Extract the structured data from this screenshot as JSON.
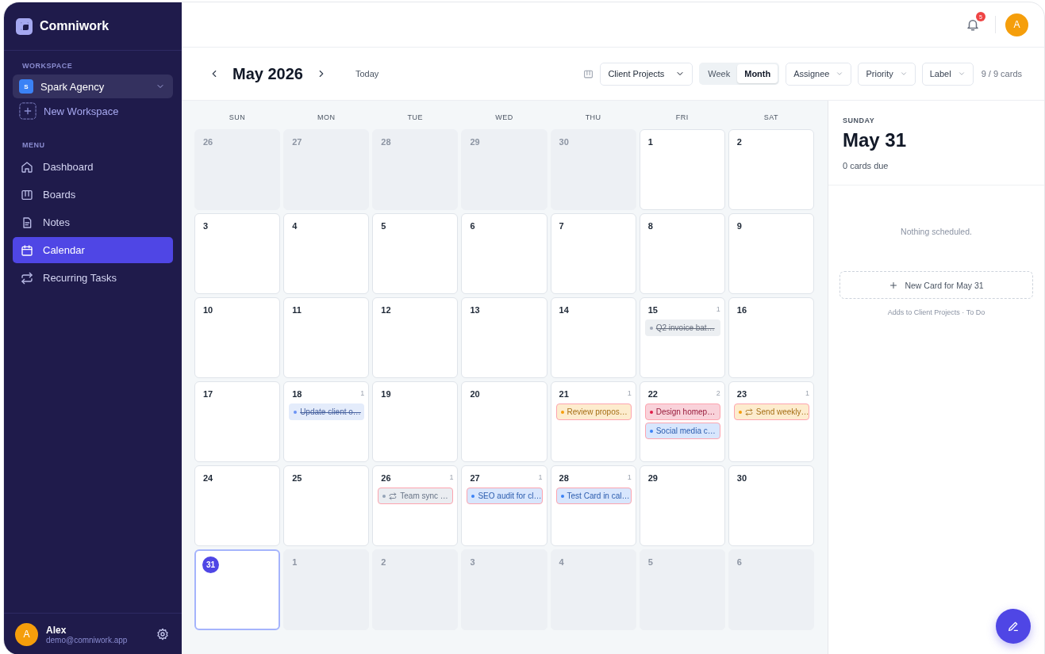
{
  "sidebar": {
    "logo": "Comniwork",
    "workspace_label": "WORKSPACE",
    "workspace": {
      "initial": "S",
      "name": "Spark Agency"
    },
    "new_workspace": "New Workspace",
    "menu_label": "MENU",
    "menu": [
      {
        "label": "Dashboard",
        "kind": "home",
        "selected": false
      },
      {
        "label": "Boards",
        "kind": "board",
        "selected": false
      },
      {
        "label": "Notes",
        "kind": "note",
        "selected": false
      },
      {
        "label": "Calendar",
        "kind": "calendar",
        "selected": true
      },
      {
        "label": "Recurring Tasks",
        "kind": "repeat",
        "selected": false
      }
    ],
    "user": {
      "initial": "A",
      "name": "Alex",
      "email": "demo@comniwork.app"
    }
  },
  "topbar": {
    "notification_count": "5",
    "avatar": "A"
  },
  "toolbar": {
    "month": "May 2026",
    "today": "Today",
    "project": "Client Projects",
    "views": [
      {
        "label": "Week",
        "selected": false
      },
      {
        "label": "Month",
        "selected": true
      }
    ],
    "filters": [
      "Assignee",
      "Priority",
      "Label"
    ],
    "card_count": "9 / 9 cards"
  },
  "calendar": {
    "weekdays": [
      "SUN",
      "MON",
      "TUE",
      "WED",
      "THU",
      "FRI",
      "SAT"
    ],
    "weeks": [
      [
        {
          "day": "26",
          "outside": true,
          "selected": false
        },
        {
          "day": "27",
          "outside": true,
          "selected": false
        },
        {
          "day": "28",
          "outside": true,
          "selected": false
        },
        {
          "day": "29",
          "outside": true,
          "selected": false
        },
        {
          "day": "30",
          "outside": true,
          "selected": false
        },
        {
          "day": "1",
          "outside": false,
          "selected": false
        },
        {
          "day": "2",
          "outside": false,
          "selected": false
        }
      ],
      [
        {
          "day": "3",
          "outside": false,
          "selected": false
        },
        {
          "day": "4",
          "outside": false,
          "selected": false
        },
        {
          "day": "5",
          "outside": false,
          "selected": false
        },
        {
          "day": "6",
          "outside": false,
          "selected": false
        },
        {
          "day": "7",
          "outside": false,
          "selected": false
        },
        {
          "day": "8",
          "outside": false,
          "selected": false
        },
        {
          "day": "9",
          "outside": false,
          "selected": false
        }
      ],
      [
        {
          "day": "10",
          "outside": false,
          "selected": false
        },
        {
          "day": "11",
          "outside": false,
          "selected": false
        },
        {
          "day": "12",
          "outside": false,
          "selected": false
        },
        {
          "day": "13",
          "outside": false,
          "selected": false
        },
        {
          "day": "14",
          "outside": false,
          "selected": false
        },
        {
          "day": "15",
          "outside": false,
          "selected": false,
          "count": "1",
          "cards": [
            {
              "title": "Q2 invoice bat…",
              "color": "#a1a8b8",
              "done": true,
              "recurring": false
            }
          ]
        },
        {
          "day": "16",
          "outside": false,
          "selected": false
        }
      ],
      [
        {
          "day": "17",
          "outside": false,
          "selected": false
        },
        {
          "day": "18",
          "outside": false,
          "selected": false,
          "count": "1",
          "cards": [
            {
              "title": "Update client o…",
              "color": "#6b93f5",
              "done": true,
              "recurring": false
            }
          ]
        },
        {
          "day": "19",
          "outside": false,
          "selected": false
        },
        {
          "day": "20",
          "outside": false,
          "selected": false
        },
        {
          "day": "21",
          "outside": false,
          "selected": false,
          "count": "1",
          "cards": [
            {
              "title": "Review propos…",
              "color": "#f59e0b",
              "done": false,
              "recurring": false
            }
          ]
        },
        {
          "day": "22",
          "outside": false,
          "selected": false,
          "count": "2",
          "cards": [
            {
              "title": "Design homep…",
              "color": "#e11d48",
              "done": false,
              "recurring": false
            },
            {
              "title": "Social media c…",
              "color": "#3b82f6",
              "done": false,
              "recurring": false
            }
          ]
        },
        {
          "day": "23",
          "outside": false,
          "selected": false,
          "count": "1",
          "cards": [
            {
              "title": "Send weekly…",
              "color": "#f59e0b",
              "done": false,
              "recurring": true
            }
          ]
        }
      ],
      [
        {
          "day": "24",
          "outside": false,
          "selected": false
        },
        {
          "day": "25",
          "outside": false,
          "selected": false
        },
        {
          "day": "26",
          "outside": false,
          "selected": false,
          "count": "1",
          "cards": [
            {
              "title": "Team sync …",
              "color": "#94a3b8",
              "done": false,
              "recurring": true
            }
          ]
        },
        {
          "day": "27",
          "outside": false,
          "selected": false,
          "count": "1",
          "cards": [
            {
              "title": "SEO audit for cl…",
              "color": "#3b82f6",
              "done": false,
              "recurring": false
            }
          ]
        },
        {
          "day": "28",
          "outside": false,
          "selected": false,
          "count": "1",
          "cards": [
            {
              "title": "Test Card in cal…",
              "color": "#3b82f6",
              "done": false,
              "recurring": false
            }
          ]
        },
        {
          "day": "29",
          "outside": false,
          "selected": false
        },
        {
          "day": "30",
          "outside": false,
          "selected": false
        }
      ],
      [
        {
          "day": "31",
          "outside": false,
          "selected": true
        },
        {
          "day": "1",
          "outside": true,
          "selected": false
        },
        {
          "day": "2",
          "outside": true,
          "selected": false
        },
        {
          "day": "3",
          "outside": true,
          "selected": false
        },
        {
          "day": "4",
          "outside": true,
          "selected": false
        },
        {
          "day": "5",
          "outside": true,
          "selected": false
        },
        {
          "day": "6",
          "outside": true,
          "selected": false
        }
      ]
    ]
  },
  "panel": {
    "weekday": "SUNDAY",
    "date": "May 31",
    "due": "0 cards due",
    "empty": "Nothing scheduled.",
    "new_card": "New Card for May 31",
    "hint": "Adds to Client Projects · To Do"
  }
}
